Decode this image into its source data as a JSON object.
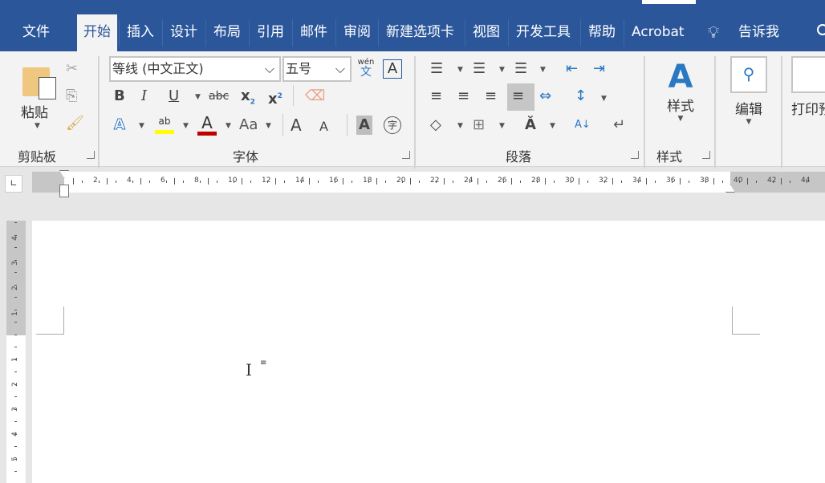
{
  "tabs": [
    "文件",
    "开始",
    "插入",
    "设计",
    "布局",
    "引用",
    "邮件",
    "审阅",
    "新建选项卡",
    "视图",
    "开发工具",
    "帮助",
    "Acrobat"
  ],
  "active_tab": "开始",
  "tell_me": "告诉我",
  "clipboard": {
    "paste": "粘贴",
    "group": "剪贴板"
  },
  "font": {
    "name": "等线 (中文正文)",
    "size": "五号",
    "group": "字体",
    "phonetic_top": "wén",
    "phonetic_bottom": "文",
    "bold": "B",
    "italic": "I",
    "underline": "U",
    "strike": "abc",
    "sub": "x",
    "sub2": "2",
    "sup": "x",
    "sup2": "2",
    "effects": "A",
    "highlight": "ab",
    "fontcolor": "A",
    "case": "Aa",
    "grow": "A",
    "shrink": "A",
    "shade": "A",
    "enclose": "字",
    "border": "A",
    "highlight_color": "#ffff00",
    "font_color": "#c00000"
  },
  "paragraph": {
    "group": "段落"
  },
  "styles": {
    "label": "样式",
    "group": "样式"
  },
  "editing": {
    "label": "编辑"
  },
  "print": {
    "label": "打印预"
  },
  "hruler": {
    "white_numbers": [
      "2",
      "4",
      "6",
      "8",
      "10",
      "12",
      "14",
      "16",
      "18",
      "20",
      "22",
      "24",
      "26",
      "28",
      "30",
      "32",
      "34",
      "36",
      "38"
    ],
    "gray_numbers": [
      "40",
      "42",
      "44"
    ]
  },
  "vruler": {
    "top_numbers": [
      "4",
      "3",
      "2",
      "1"
    ],
    "bottom_numbers": [
      "1",
      "2",
      "3",
      "4",
      "5"
    ]
  },
  "colors": {
    "accent": "#2b579a"
  }
}
